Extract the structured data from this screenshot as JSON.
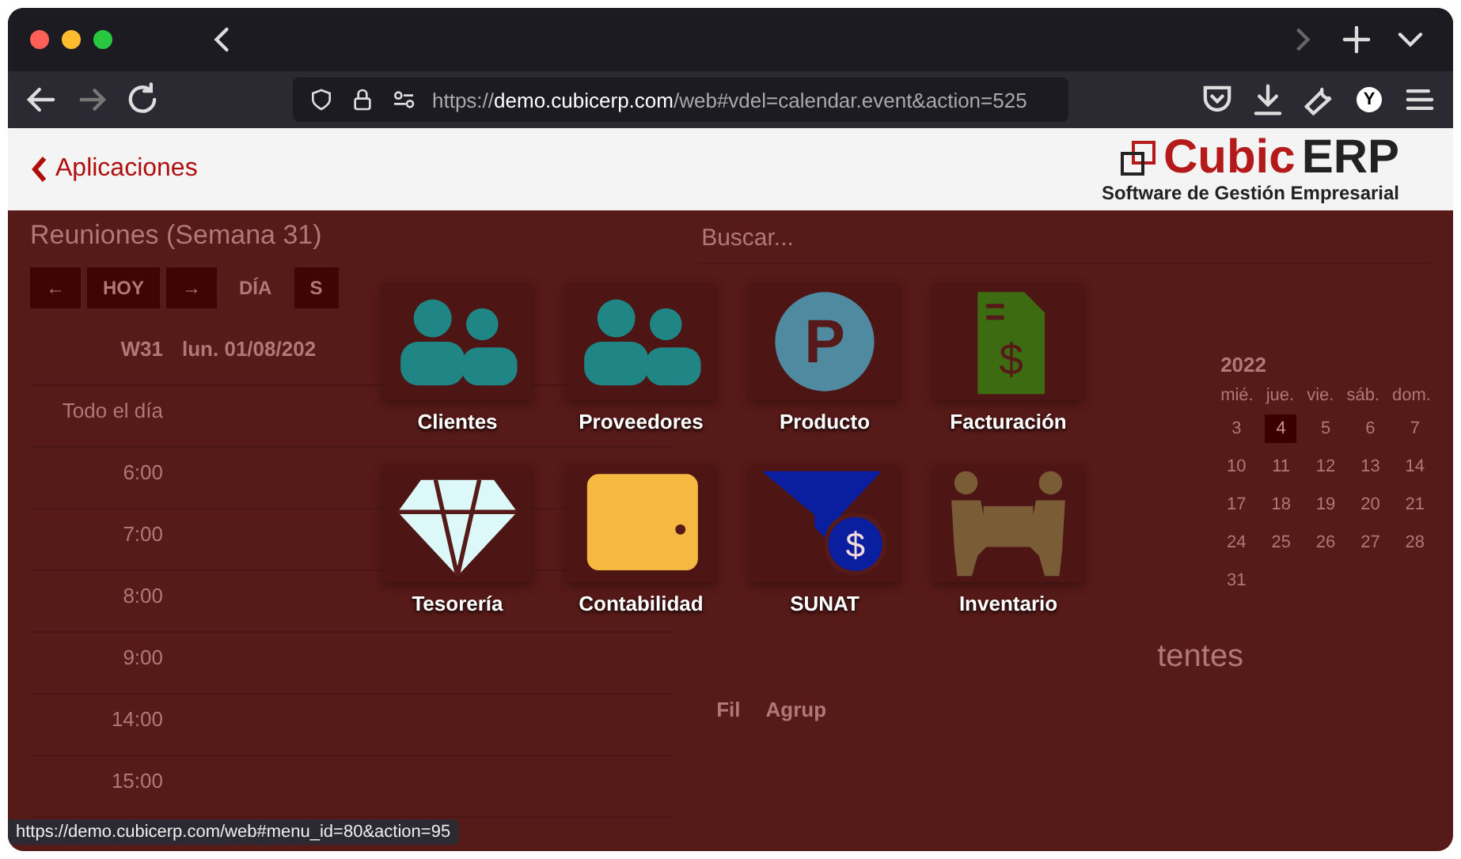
{
  "browser": {
    "url_scheme": "https://",
    "url_host": "demo.cubicerp.com",
    "url_path": "/web#vdel=calendar.event&action=525",
    "status_url": "https://demo.cubicerp.com/web#menu_id=80&action=95",
    "avatar_letter": "Y"
  },
  "header": {
    "back_label": "Aplicaciones",
    "logo_brand": "Cubic",
    "logo_suffix": "ERP",
    "logo_subtitle": "Software de Gestión Empresarial"
  },
  "calendar": {
    "title": "Reuniones (Semana 31)",
    "search_placeholder": "Buscar...",
    "nav": [
      "←",
      "HOY",
      "→"
    ],
    "views": [
      {
        "label": "DÍA",
        "selected": false
      },
      {
        "label": "S",
        "selected": true
      }
    ],
    "filters": [
      "Fil",
      "Agrup"
    ],
    "week": "W31",
    "day_header": "lun. 01/08/202",
    "all_day": "Todo el día",
    "hours": [
      "6:00",
      "7:00",
      "8:00",
      "9:00",
      "14:00",
      "15:00"
    ]
  },
  "mini_calendar": {
    "month": "2022",
    "weekdays": [
      "mié.",
      "jue.",
      "vie.",
      "sáb.",
      "dom."
    ],
    "weeks": [
      [
        {
          "day": "3",
          "selected": false
        },
        {
          "day": "4",
          "selected": true
        },
        {
          "day": "5",
          "selected": false
        },
        {
          "day": "6",
          "selected": false
        },
        {
          "day": "7",
          "selected": false
        }
      ],
      [
        {
          "day": "10",
          "selected": false
        },
        {
          "day": "11",
          "selected": false
        },
        {
          "day": "12",
          "selected": false
        },
        {
          "day": "13",
          "selected": false
        },
        {
          "day": "14",
          "selected": false
        }
      ],
      [
        {
          "day": "17",
          "selected": false
        },
        {
          "day": "18",
          "selected": false
        },
        {
          "day": "19",
          "selected": false
        },
        {
          "day": "20",
          "selected": false
        },
        {
          "day": "21",
          "selected": false
        }
      ],
      [
        {
          "day": "24",
          "selected": false
        },
        {
          "day": "25",
          "selected": false
        },
        {
          "day": "26",
          "selected": false
        },
        {
          "day": "27",
          "selected": false
        },
        {
          "day": "28",
          "selected": false
        }
      ],
      [
        {
          "day": "31",
          "selected": false
        }
      ]
    ]
  },
  "side_heading": "tentes",
  "apps": [
    {
      "name": "Clientes",
      "kind": "people",
      "color": "#1f8585"
    },
    {
      "name": "Proveedores",
      "kind": "people",
      "color": "#1f8585"
    },
    {
      "name": "Producto",
      "kind": "parking",
      "color": "#4f8aa0",
      "icon_text": "P"
    },
    {
      "name": "Facturación",
      "kind": "invoice",
      "color": "#3d6b12",
      "icon_text": "$"
    },
    {
      "name": "Tesorería",
      "kind": "diamond",
      "color": "#dcf8f8"
    },
    {
      "name": "Contabilidad",
      "kind": "wallet",
      "color": "#f5b942"
    },
    {
      "name": "SUNAT",
      "kind": "funnel",
      "color": "#0a1fa0",
      "icon_text": "$"
    },
    {
      "name": "Inventario",
      "kind": "movers",
      "color": "#7a5c36"
    }
  ]
}
